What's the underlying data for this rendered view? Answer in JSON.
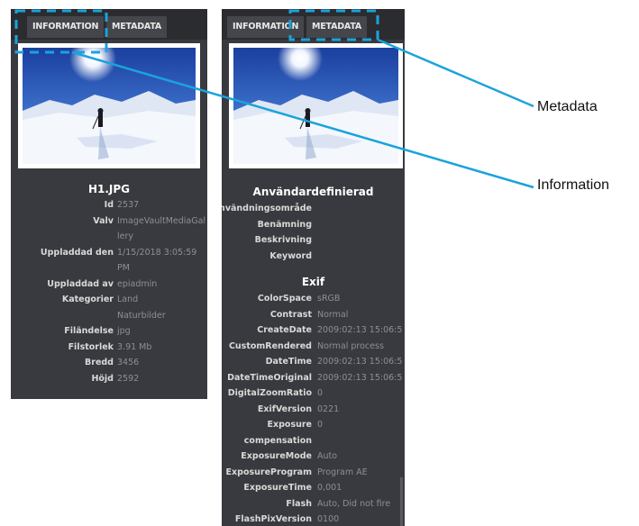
{
  "left_panel": {
    "tabs": [
      "INFORMATION",
      "METADATA"
    ],
    "filename": "H1.JPG",
    "rows": [
      {
        "label": "Id",
        "value": "2537"
      },
      {
        "label": "Valv",
        "value": "ImageVaultMediaGal"
      },
      {
        "label": "",
        "value": "lery"
      },
      {
        "label": "Uppladdad den",
        "value": "1/15/2018 3:05:59"
      },
      {
        "label": "",
        "value": "PM"
      },
      {
        "label": "Uppladdad av",
        "value": "epiadmin"
      },
      {
        "label": "Kategorier",
        "value": "Land"
      },
      {
        "label": "",
        "value": "Naturbilder"
      },
      {
        "label": "Filändelse",
        "value": "jpg"
      },
      {
        "label": "Filstorlek",
        "value": "3.91 Mb"
      },
      {
        "label": "Bredd",
        "value": "3456"
      },
      {
        "label": "Höjd",
        "value": "2592"
      }
    ]
  },
  "right_panel": {
    "tabs": [
      "INFORMATION",
      "METADATA"
    ],
    "user_defined": {
      "title": "Användardefinierad",
      "rows": [
        {
          "label": "Användningsområde",
          "value": ""
        },
        {
          "label": "Benämning",
          "value": ""
        },
        {
          "label": "Beskrivning",
          "value": ""
        },
        {
          "label": "Keyword",
          "value": ""
        }
      ]
    },
    "exif": {
      "title": "Exif",
      "rows": [
        {
          "label": "ColorSpace",
          "value": "sRGB"
        },
        {
          "label": "Contrast",
          "value": "Normal"
        },
        {
          "label": "CreateDate",
          "value": "2009:02:13 15:06:5"
        },
        {
          "label": "CustomRendered",
          "value": "Normal process"
        },
        {
          "label": "DateTime",
          "value": "2009:02:13 15:06:5"
        },
        {
          "label": "DateTimeOriginal",
          "value": "2009:02:13 15:06:5"
        },
        {
          "label": "DigitalZoomRatio",
          "value": "0"
        },
        {
          "label": "ExifVersion",
          "value": "0221"
        },
        {
          "label": "Exposure",
          "value": "0"
        },
        {
          "label": "compensation",
          "value": ""
        },
        {
          "label": "ExposureMode",
          "value": "Auto"
        },
        {
          "label": "ExposureProgram",
          "value": "Program AE"
        },
        {
          "label": "ExposureTime",
          "value": "0,001"
        },
        {
          "label": "Flash",
          "value": "Auto, Did not fire"
        },
        {
          "label": "FlashPixVersion",
          "value": "0100"
        }
      ]
    }
  },
  "callouts": {
    "metadata": "Metadata",
    "information": "Information"
  },
  "colors": {
    "panel_bg": "#393a3f",
    "top_bar": "#2b2c30",
    "callout_line": "#1aa3dc",
    "highlight_dash": "#1aa3dc"
  },
  "icons": [
    "snow-photo-thumbnail"
  ]
}
